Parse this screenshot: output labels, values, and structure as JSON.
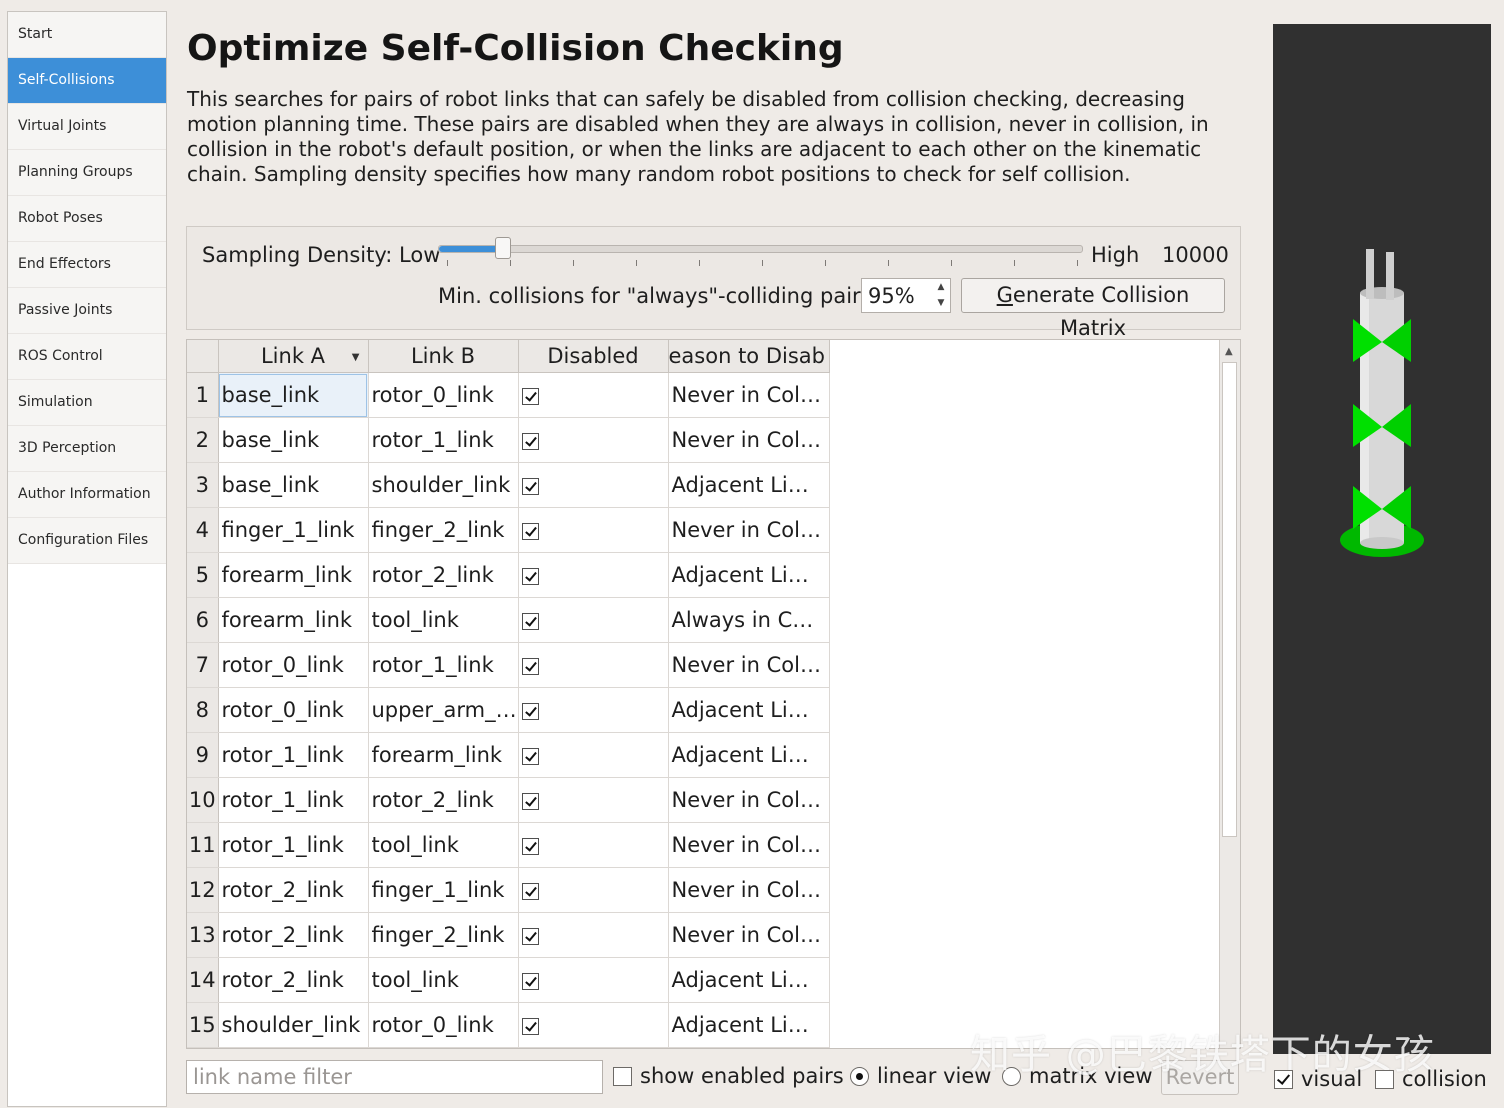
{
  "sidebar": {
    "items": [
      {
        "label": "Start",
        "active": false
      },
      {
        "label": "Self-Collisions",
        "active": true
      },
      {
        "label": "Virtual Joints",
        "active": false
      },
      {
        "label": "Planning Groups",
        "active": false
      },
      {
        "label": "Robot Poses",
        "active": false
      },
      {
        "label": "End Effectors",
        "active": false
      },
      {
        "label": "Passive Joints",
        "active": false
      },
      {
        "label": "ROS Control",
        "active": false
      },
      {
        "label": "Simulation",
        "active": false
      },
      {
        "label": "3D Perception",
        "active": false
      },
      {
        "label": "Author Information",
        "active": false
      },
      {
        "label": "Configuration Files",
        "active": false
      }
    ]
  },
  "page": {
    "title": "Optimize Self-Collision Checking",
    "description": "This searches for pairs of robot links that can safely be disabled from collision checking, decreasing motion planning time. These pairs are disabled when they are always in collision, never in collision, in collision in the robot's default position, or when the links are adjacent to each other on the kinematic chain. Sampling density specifies how many random robot positions to check for self collision."
  },
  "sampling": {
    "label": "Sampling Density: Low",
    "high_label": "High",
    "value": "10000",
    "slider_fraction": 0.1,
    "min_collisions_label": "Min. collisions for \"always\"-colliding pairs:",
    "min_collisions_value": "95%",
    "generate_button_first": "G",
    "generate_button_rest": "enerate Collision Matrix"
  },
  "table": {
    "headers": {
      "link_a": "Link A",
      "link_b": "Link B",
      "disabled": "Disabled",
      "reason": "eason to Disab"
    },
    "rows": [
      {
        "n": "1",
        "a": "base_link",
        "b": "rotor_0_link",
        "disabled": true,
        "reason": "Never in Col…"
      },
      {
        "n": "2",
        "a": "base_link",
        "b": "rotor_1_link",
        "disabled": true,
        "reason": "Never in Col…"
      },
      {
        "n": "3",
        "a": "base_link",
        "b": "shoulder_link",
        "disabled": true,
        "reason": "Adjacent Li…"
      },
      {
        "n": "4",
        "a": "finger_1_link",
        "b": "finger_2_link",
        "disabled": true,
        "reason": "Never in Col…"
      },
      {
        "n": "5",
        "a": "forearm_link",
        "b": "rotor_2_link",
        "disabled": true,
        "reason": "Adjacent Li…"
      },
      {
        "n": "6",
        "a": "forearm_link",
        "b": "tool_link",
        "disabled": true,
        "reason": "Always in C…"
      },
      {
        "n": "7",
        "a": "rotor_0_link",
        "b": "rotor_1_link",
        "disabled": true,
        "reason": "Never in Col…"
      },
      {
        "n": "8",
        "a": "rotor_0_link",
        "b": "upper_arm_…",
        "disabled": true,
        "reason": "Adjacent Li…"
      },
      {
        "n": "9",
        "a": "rotor_1_link",
        "b": "forearm_link",
        "disabled": true,
        "reason": "Adjacent Li…"
      },
      {
        "n": "10",
        "a": "rotor_1_link",
        "b": "rotor_2_link",
        "disabled": true,
        "reason": "Never in Col…"
      },
      {
        "n": "11",
        "a": "rotor_1_link",
        "b": "tool_link",
        "disabled": true,
        "reason": "Never in Col…"
      },
      {
        "n": "12",
        "a": "rotor_2_link",
        "b": "finger_1_link",
        "disabled": true,
        "reason": "Never in Col…"
      },
      {
        "n": "13",
        "a": "rotor_2_link",
        "b": "finger_2_link",
        "disabled": true,
        "reason": "Never in Col…"
      },
      {
        "n": "14",
        "a": "rotor_2_link",
        "b": "tool_link",
        "disabled": true,
        "reason": "Adjacent Li…"
      },
      {
        "n": "15",
        "a": "shoulder_link",
        "b": "rotor_0_link",
        "disabled": true,
        "reason": "Adjacent Li…"
      },
      {
        "n": "",
        "a": "",
        "b": "",
        "disabled": false,
        "reason": ""
      }
    ]
  },
  "bottom": {
    "filter_placeholder": "link name filter",
    "show_enabled_label": "show enabled pairs",
    "linear_view_label": "linear view",
    "matrix_view_label": "matrix view",
    "revert_label": "Revert",
    "visual_label": "visual",
    "collision_label": "collision"
  },
  "viewport": {
    "watermark": "知乎 @巴黎铁塔下的女孩",
    "colors": {
      "background": "#303030",
      "link": "#d8d8d8",
      "rotor": "#00e000",
      "base": "#00b800"
    }
  }
}
